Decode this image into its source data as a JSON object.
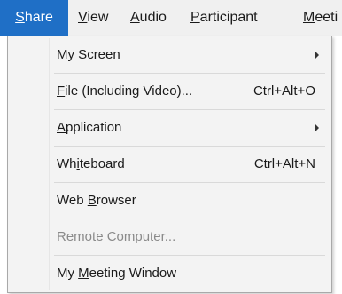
{
  "menubar": {
    "items": [
      {
        "pre": "",
        "key": "S",
        "post": "hare"
      },
      {
        "pre": "",
        "key": "V",
        "post": "iew"
      },
      {
        "pre": "",
        "key": "A",
        "post": "udio"
      },
      {
        "pre": "",
        "key": "P",
        "post": "articipant"
      },
      {
        "pre": "",
        "key": "M",
        "post": "eeti"
      }
    ]
  },
  "share_menu": {
    "items": [
      {
        "pre": "My ",
        "key": "S",
        "post": "creen",
        "shortcut": "",
        "has_submenu": true,
        "enabled": true
      },
      {
        "pre": "",
        "key": "F",
        "post": "ile (Including Video)...",
        "shortcut": "Ctrl+Alt+O",
        "has_submenu": false,
        "enabled": true
      },
      {
        "pre": "",
        "key": "A",
        "post": "pplication",
        "shortcut": "",
        "has_submenu": true,
        "enabled": true
      },
      {
        "pre": "Wh",
        "key": "i",
        "post": "teboard",
        "shortcut": "Ctrl+Alt+N",
        "has_submenu": false,
        "enabled": true
      },
      {
        "pre": "Web ",
        "key": "B",
        "post": "rowser",
        "shortcut": "",
        "has_submenu": false,
        "enabled": true
      },
      {
        "pre": "",
        "key": "R",
        "post": "emote Computer...",
        "shortcut": "",
        "has_submenu": false,
        "enabled": false
      },
      {
        "pre": "My ",
        "key": "M",
        "post": "eeting Window",
        "shortcut": "",
        "has_submenu": false,
        "enabled": true
      }
    ]
  },
  "colors": {
    "menubar_active_bg": "#1f6fc6",
    "menu_bg": "#f3f3f3",
    "disabled_text": "#8a8a8a"
  }
}
